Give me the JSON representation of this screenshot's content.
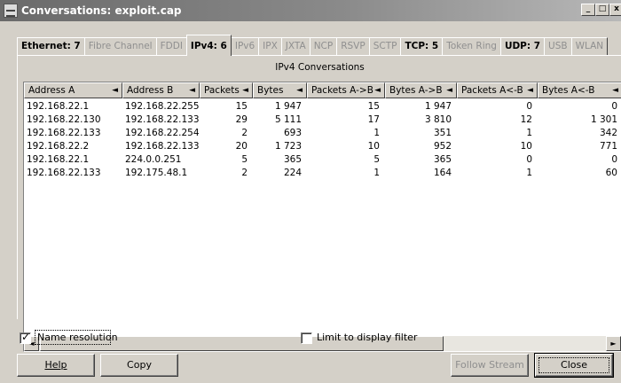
{
  "window": {
    "title": "Conversations: exploit.cap",
    "minimize": "_",
    "maximize": "□",
    "close": "x"
  },
  "tabs": [
    {
      "label": "Ethernet: 7",
      "active": true
    },
    {
      "label": "Fibre Channel",
      "active": false
    },
    {
      "label": "FDDI",
      "active": false
    },
    {
      "label": "IPv4: 6",
      "active": true,
      "selected": true
    },
    {
      "label": "IPv6",
      "active": false
    },
    {
      "label": "IPX",
      "active": false
    },
    {
      "label": "JXTA",
      "active": false
    },
    {
      "label": "NCP",
      "active": false
    },
    {
      "label": "RSVP",
      "active": false
    },
    {
      "label": "SCTP",
      "active": false
    },
    {
      "label": "TCP: 5",
      "active": true
    },
    {
      "label": "Token Ring",
      "active": false
    },
    {
      "label": "UDP: 7",
      "active": true
    },
    {
      "label": "USB",
      "active": false
    },
    {
      "label": "WLAN",
      "active": false
    }
  ],
  "panel_title": "IPv4 Conversations",
  "columns": [
    "Address A",
    "Address B",
    "Packets",
    "Bytes",
    "Packets A->B",
    "Bytes A->B",
    "Packets A<-B",
    "Bytes A<-B"
  ],
  "rows": [
    [
      "192.168.22.1",
      "192.168.22.255",
      "15",
      "1 947",
      "15",
      "1 947",
      "0",
      "0"
    ],
    [
      "192.168.22.130",
      "192.168.22.133",
      "29",
      "5 111",
      "17",
      "3 810",
      "12",
      "1 301"
    ],
    [
      "192.168.22.133",
      "192.168.22.254",
      "2",
      "693",
      "1",
      "351",
      "1",
      "342"
    ],
    [
      "192.168.22.2",
      "192.168.22.133",
      "20",
      "1 723",
      "10",
      "952",
      "10",
      "771"
    ],
    [
      "192.168.22.1",
      "224.0.0.251",
      "5",
      "365",
      "5",
      "365",
      "0",
      "0"
    ],
    [
      "192.168.22.133",
      "192.175.48.1",
      "2",
      "224",
      "1",
      "164",
      "1",
      "60"
    ]
  ],
  "sort_arrow": "◄",
  "name_resolution": {
    "label": "Name resolution",
    "checked": true
  },
  "limit_filter": {
    "label": "Limit to display filter",
    "checked": false
  },
  "buttons": {
    "help": "Help",
    "copy": "Copy",
    "follow_stream": "Follow Stream",
    "close": "Close"
  }
}
